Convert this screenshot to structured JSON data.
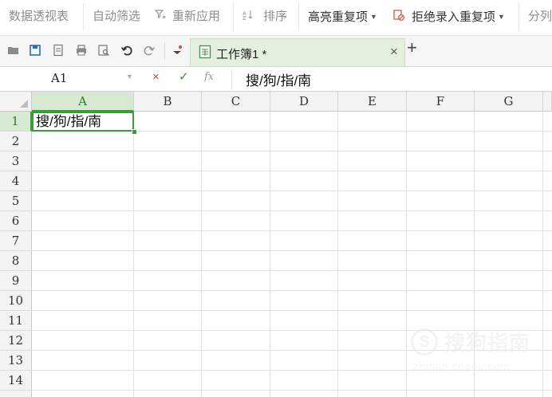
{
  "ribbon": {
    "items": [
      {
        "label": "数据透视表"
      },
      {
        "label": "自动筛选"
      },
      {
        "label": "重新应用"
      },
      {
        "label": "排序"
      },
      {
        "label": "高亮重复项"
      },
      {
        "label": "拒绝录入重复项"
      },
      {
        "label": "分列"
      }
    ]
  },
  "quick_access": {
    "icons": [
      "open-icon",
      "save-icon",
      "export-pdf-icon",
      "print-icon",
      "print-preview-icon",
      "undo-icon",
      "redo-icon",
      "customize-icon"
    ]
  },
  "tab": {
    "title": "工作簿1 *",
    "close": "×",
    "new": "+"
  },
  "formula_bar": {
    "name_box": "A1",
    "cancel": "×",
    "confirm": "✓",
    "fx": "fx",
    "content": "搜/狗/指/南"
  },
  "grid": {
    "columns": [
      "A",
      "B",
      "C",
      "D",
      "E",
      "F",
      "G"
    ],
    "rows": [
      "1",
      "2",
      "3",
      "4",
      "5",
      "6",
      "7",
      "8",
      "9",
      "10",
      "11",
      "12",
      "13",
      "14"
    ],
    "active_cell": "A1",
    "cells": {
      "A1": "搜/狗/指/南"
    }
  },
  "watermark": {
    "logo": "S",
    "text": "搜狗指南",
    "url": "zhinan.sogou.com"
  },
  "colors": {
    "accent": "#3c9a3c",
    "header_active": "#d7e9d3",
    "tab_bg": "#e4efe0",
    "cancel": "#d94a3a",
    "confirm": "#3a8a3a"
  }
}
